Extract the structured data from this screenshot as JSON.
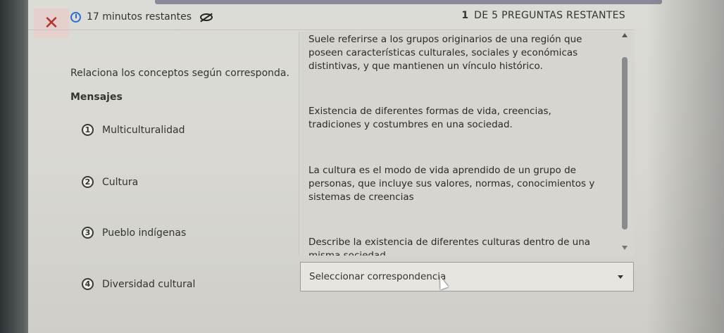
{
  "header": {
    "timer_text": "17 minutos restantes",
    "question_number": "1",
    "question_count_text": "DE 5 PREGUNTAS RESTANTES"
  },
  "instructions": "Relaciona los conceptos según corresponda.",
  "section_title": "Mensajes",
  "concepts": [
    {
      "number": "1",
      "label": "Multiculturalidad"
    },
    {
      "number": "2",
      "label": "Cultura"
    },
    {
      "number": "3",
      "label": "Pueblo indígenas"
    },
    {
      "number": "4",
      "label": "Diversidad cultural"
    }
  ],
  "definitions": [
    "Suele referirse a los grupos originarios de una región que poseen características culturales, sociales y económicas distintivas, y que mantienen un vínculo histórico.",
    "Existencia de diferentes formas de vida, creencias, tradiciones y costumbres en una sociedad.",
    "La cultura es el modo de vida aprendido de un grupo de personas, que incluye sus valores, normas, conocimientos y sistemas de creencias",
    "Describe la existencia de diferentes culturas dentro de una misma sociedad"
  ],
  "select": {
    "value": "Seleccionar correspondencia"
  },
  "icons": {
    "close": "close-icon",
    "timer": "clock-icon",
    "hide": "eye-slash-icon"
  },
  "colors": {
    "close": "#b3362e",
    "timer": "#2f6bd6"
  }
}
